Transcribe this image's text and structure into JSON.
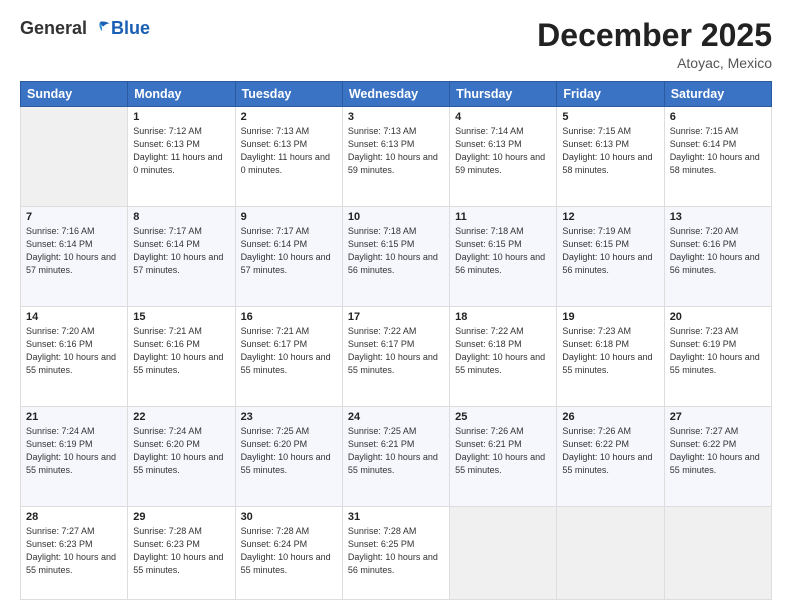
{
  "header": {
    "logo": {
      "general": "General",
      "blue": "Blue"
    },
    "title": "December 2025",
    "location": "Atoyac, Mexico"
  },
  "days_of_week": [
    "Sunday",
    "Monday",
    "Tuesday",
    "Wednesday",
    "Thursday",
    "Friday",
    "Saturday"
  ],
  "weeks": [
    [
      {
        "day": "",
        "sunrise": "",
        "sunset": "",
        "daylight": ""
      },
      {
        "day": "1",
        "sunrise": "Sunrise: 7:12 AM",
        "sunset": "Sunset: 6:13 PM",
        "daylight": "Daylight: 11 hours and 0 minutes."
      },
      {
        "day": "2",
        "sunrise": "Sunrise: 7:13 AM",
        "sunset": "Sunset: 6:13 PM",
        "daylight": "Daylight: 11 hours and 0 minutes."
      },
      {
        "day": "3",
        "sunrise": "Sunrise: 7:13 AM",
        "sunset": "Sunset: 6:13 PM",
        "daylight": "Daylight: 10 hours and 59 minutes."
      },
      {
        "day": "4",
        "sunrise": "Sunrise: 7:14 AM",
        "sunset": "Sunset: 6:13 PM",
        "daylight": "Daylight: 10 hours and 59 minutes."
      },
      {
        "day": "5",
        "sunrise": "Sunrise: 7:15 AM",
        "sunset": "Sunset: 6:13 PM",
        "daylight": "Daylight: 10 hours and 58 minutes."
      },
      {
        "day": "6",
        "sunrise": "Sunrise: 7:15 AM",
        "sunset": "Sunset: 6:14 PM",
        "daylight": "Daylight: 10 hours and 58 minutes."
      }
    ],
    [
      {
        "day": "7",
        "sunrise": "Sunrise: 7:16 AM",
        "sunset": "Sunset: 6:14 PM",
        "daylight": "Daylight: 10 hours and 57 minutes."
      },
      {
        "day": "8",
        "sunrise": "Sunrise: 7:17 AM",
        "sunset": "Sunset: 6:14 PM",
        "daylight": "Daylight: 10 hours and 57 minutes."
      },
      {
        "day": "9",
        "sunrise": "Sunrise: 7:17 AM",
        "sunset": "Sunset: 6:14 PM",
        "daylight": "Daylight: 10 hours and 57 minutes."
      },
      {
        "day": "10",
        "sunrise": "Sunrise: 7:18 AM",
        "sunset": "Sunset: 6:15 PM",
        "daylight": "Daylight: 10 hours and 56 minutes."
      },
      {
        "day": "11",
        "sunrise": "Sunrise: 7:18 AM",
        "sunset": "Sunset: 6:15 PM",
        "daylight": "Daylight: 10 hours and 56 minutes."
      },
      {
        "day": "12",
        "sunrise": "Sunrise: 7:19 AM",
        "sunset": "Sunset: 6:15 PM",
        "daylight": "Daylight: 10 hours and 56 minutes."
      },
      {
        "day": "13",
        "sunrise": "Sunrise: 7:20 AM",
        "sunset": "Sunset: 6:16 PM",
        "daylight": "Daylight: 10 hours and 56 minutes."
      }
    ],
    [
      {
        "day": "14",
        "sunrise": "Sunrise: 7:20 AM",
        "sunset": "Sunset: 6:16 PM",
        "daylight": "Daylight: 10 hours and 55 minutes."
      },
      {
        "day": "15",
        "sunrise": "Sunrise: 7:21 AM",
        "sunset": "Sunset: 6:16 PM",
        "daylight": "Daylight: 10 hours and 55 minutes."
      },
      {
        "day": "16",
        "sunrise": "Sunrise: 7:21 AM",
        "sunset": "Sunset: 6:17 PM",
        "daylight": "Daylight: 10 hours and 55 minutes."
      },
      {
        "day": "17",
        "sunrise": "Sunrise: 7:22 AM",
        "sunset": "Sunset: 6:17 PM",
        "daylight": "Daylight: 10 hours and 55 minutes."
      },
      {
        "day": "18",
        "sunrise": "Sunrise: 7:22 AM",
        "sunset": "Sunset: 6:18 PM",
        "daylight": "Daylight: 10 hours and 55 minutes."
      },
      {
        "day": "19",
        "sunrise": "Sunrise: 7:23 AM",
        "sunset": "Sunset: 6:18 PM",
        "daylight": "Daylight: 10 hours and 55 minutes."
      },
      {
        "day": "20",
        "sunrise": "Sunrise: 7:23 AM",
        "sunset": "Sunset: 6:19 PM",
        "daylight": "Daylight: 10 hours and 55 minutes."
      }
    ],
    [
      {
        "day": "21",
        "sunrise": "Sunrise: 7:24 AM",
        "sunset": "Sunset: 6:19 PM",
        "daylight": "Daylight: 10 hours and 55 minutes."
      },
      {
        "day": "22",
        "sunrise": "Sunrise: 7:24 AM",
        "sunset": "Sunset: 6:20 PM",
        "daylight": "Daylight: 10 hours and 55 minutes."
      },
      {
        "day": "23",
        "sunrise": "Sunrise: 7:25 AM",
        "sunset": "Sunset: 6:20 PM",
        "daylight": "Daylight: 10 hours and 55 minutes."
      },
      {
        "day": "24",
        "sunrise": "Sunrise: 7:25 AM",
        "sunset": "Sunset: 6:21 PM",
        "daylight": "Daylight: 10 hours and 55 minutes."
      },
      {
        "day": "25",
        "sunrise": "Sunrise: 7:26 AM",
        "sunset": "Sunset: 6:21 PM",
        "daylight": "Daylight: 10 hours and 55 minutes."
      },
      {
        "day": "26",
        "sunrise": "Sunrise: 7:26 AM",
        "sunset": "Sunset: 6:22 PM",
        "daylight": "Daylight: 10 hours and 55 minutes."
      },
      {
        "day": "27",
        "sunrise": "Sunrise: 7:27 AM",
        "sunset": "Sunset: 6:22 PM",
        "daylight": "Daylight: 10 hours and 55 minutes."
      }
    ],
    [
      {
        "day": "28",
        "sunrise": "Sunrise: 7:27 AM",
        "sunset": "Sunset: 6:23 PM",
        "daylight": "Daylight: 10 hours and 55 minutes."
      },
      {
        "day": "29",
        "sunrise": "Sunrise: 7:28 AM",
        "sunset": "Sunset: 6:23 PM",
        "daylight": "Daylight: 10 hours and 55 minutes."
      },
      {
        "day": "30",
        "sunrise": "Sunrise: 7:28 AM",
        "sunset": "Sunset: 6:24 PM",
        "daylight": "Daylight: 10 hours and 55 minutes."
      },
      {
        "day": "31",
        "sunrise": "Sunrise: 7:28 AM",
        "sunset": "Sunset: 6:25 PM",
        "daylight": "Daylight: 10 hours and 56 minutes."
      },
      {
        "day": "",
        "sunrise": "",
        "sunset": "",
        "daylight": ""
      },
      {
        "day": "",
        "sunrise": "",
        "sunset": "",
        "daylight": ""
      },
      {
        "day": "",
        "sunrise": "",
        "sunset": "",
        "daylight": ""
      }
    ]
  ]
}
